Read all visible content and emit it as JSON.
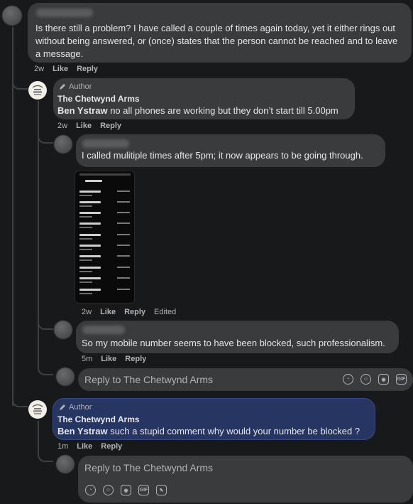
{
  "comments": [
    {
      "text": "Is there still a problem? I have called a couple of times again today, yet it either rings out without being answered, or (once) states that the person cannot be reached and to leave a message.",
      "time": "2w",
      "like": "Like",
      "reply": "Reply"
    },
    {
      "author_badge": "Author",
      "name": "The Chetwynd Arms",
      "mention": "Ben Ystraw",
      "text": " no all phones are working but they don’t start till 5.00pm",
      "time": "2w",
      "like": "Like",
      "reply": "Reply"
    },
    {
      "text": "I called mulitiple times after 5pm; it now appears to be going through.",
      "time": "2w",
      "like": "Like",
      "reply": "Reply",
      "edited": "Edited"
    },
    {
      "text": "So my mobile number seems to have been blocked, such professionalism.",
      "time": "5m",
      "like": "Like",
      "reply": "Reply"
    },
    {
      "author_badge": "Author",
      "name": "The Chetwynd Arms",
      "mention": "Ben Ystraw",
      "text": " such a stupid comment why would your number be blocked ?",
      "time": "1m",
      "like": "Like",
      "reply": "Reply"
    }
  ],
  "reply_boxes": [
    {
      "placeholder": "Reply to The Chetwynd Arms"
    },
    {
      "placeholder": "Reply to The Chetwynd Arms"
    }
  ],
  "attachment": {
    "type": "screenshot",
    "title": "Call logs"
  },
  "icons": {
    "pencil": "pencil-icon",
    "emoji": "emoji-icon",
    "camera": "camera-icon",
    "gif": "gif-icon",
    "avatar": "avatar-icon",
    "sticker": "sticker-icon"
  },
  "gif_label": "GIF",
  "colors": {
    "background": "#18191a",
    "bubble": "#3a3b3c",
    "highlight_bubble": "#263561",
    "meta_text": "#b0b3b8"
  }
}
